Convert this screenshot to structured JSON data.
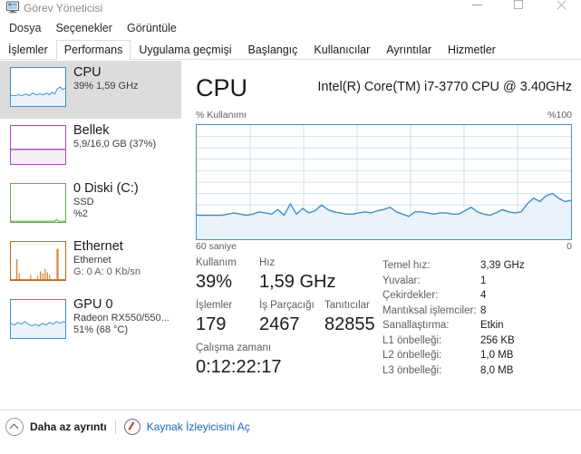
{
  "window": {
    "title": "Görev Yöneticisi",
    "icon": "task-manager-icon",
    "controls": {
      "minimize": "—",
      "maximize": "□",
      "close": "✕"
    }
  },
  "menubar": {
    "items": [
      "Dosya",
      "Seçenekler",
      "Görüntüle"
    ]
  },
  "tabs": {
    "items": [
      {
        "label": "İşlemler",
        "active": false
      },
      {
        "label": "Performans",
        "active": true
      },
      {
        "label": "Uygulama geçmişi",
        "active": false
      },
      {
        "label": "Başlangıç",
        "active": false
      },
      {
        "label": "Kullanıcılar",
        "active": false
      },
      {
        "label": "Ayrıntılar",
        "active": false
      },
      {
        "label": "Hizmetler",
        "active": false
      }
    ]
  },
  "sidebar": {
    "items": [
      {
        "name": "cpu",
        "title": "CPU",
        "sub1": "39%  1,59 GHz",
        "sub2": "",
        "selected": true,
        "color": "#3f8fc4"
      },
      {
        "name": "memory",
        "title": "Bellek",
        "sub1": "5,9/16,0 GB (37%)",
        "sub2": "",
        "selected": false,
        "color": "#ab47bc"
      },
      {
        "name": "disk",
        "title": "0 Diski (C:)",
        "sub1": "SSD",
        "sub2": "%2",
        "selected": false,
        "color": "#6aab4a"
      },
      {
        "name": "ethernet",
        "title": "Ethernet",
        "sub1": "Ethernet",
        "sub2": "G: 0 A: 0 Kb/sn",
        "selected": false,
        "color": "#c46a22"
      },
      {
        "name": "gpu",
        "title": "GPU 0",
        "sub1": "Radeon RX550/550...",
        "sub2": "51%  (68 °C)",
        "selected": false,
        "color": "#3f8fc4"
      }
    ]
  },
  "detail": {
    "title": "CPU",
    "cpu_name": "Intel(R) Core(TM) i7-3770 CPU @ 3.40GHz",
    "graph_axis_top_left": "% Kullanımı",
    "graph_axis_top_right": "%100",
    "graph_axis_bottom_left": "60 saniye",
    "graph_axis_bottom_right": "0",
    "stats": [
      {
        "labels": [
          "Kullanım",
          "Hız"
        ],
        "values": [
          "39%",
          "1,59 GHz"
        ]
      },
      {
        "labels": [
          "İşlemler",
          "İş Parçacığı",
          "Tanıtıcılar"
        ],
        "values": [
          "179",
          "2467",
          "82855"
        ]
      },
      {
        "labels": [
          "Çalışma zamanı"
        ],
        "values": [
          "0:12:22:17"
        ]
      }
    ],
    "info": [
      {
        "key": "Temel hız:",
        "value": "3,39 GHz"
      },
      {
        "key": "Yuvalar:",
        "value": "1"
      },
      {
        "key": "Çekirdekler:",
        "value": "4"
      },
      {
        "key": "Mantıksal işlemciler:",
        "value": "8"
      },
      {
        "key": "Sanallaştırma:",
        "value": "Etkin"
      },
      {
        "key": "L1 önbelleği:",
        "value": "256 KB"
      },
      {
        "key": "L2 önbelleği:",
        "value": "1,0 MB"
      },
      {
        "key": "L3 önbelleği:",
        "value": "8,0 MB"
      }
    ]
  },
  "footer": {
    "less_details": "Daha az ayrıntı",
    "resource_monitor": "Kaynak İzleyicisini Aç"
  },
  "chart_data": {
    "type": "area",
    "title": "% Kullanımı",
    "xlabel": "60 saniye",
    "ylabel": "% Kullanımı",
    "ylim": [
      0,
      100
    ],
    "xlim": [
      60,
      0
    ],
    "grid": true,
    "grid_rows": 10,
    "grid_cols": 6,
    "line_color": "#3f8fc4",
    "fill_color": "#eaf3fa",
    "values": [
      21,
      21,
      21,
      21,
      21,
      22,
      23,
      22,
      21,
      22,
      24,
      23,
      22,
      26,
      21,
      31,
      22,
      27,
      23,
      25,
      30,
      26,
      24,
      23,
      22,
      22,
      23,
      24,
      23,
      25,
      26,
      28,
      25,
      22,
      20,
      24,
      24,
      23,
      22,
      23,
      23,
      22,
      22,
      25,
      28,
      24,
      22,
      21,
      23,
      26,
      24,
      23,
      24,
      31,
      36,
      33,
      38,
      40,
      36,
      33,
      34
    ]
  }
}
